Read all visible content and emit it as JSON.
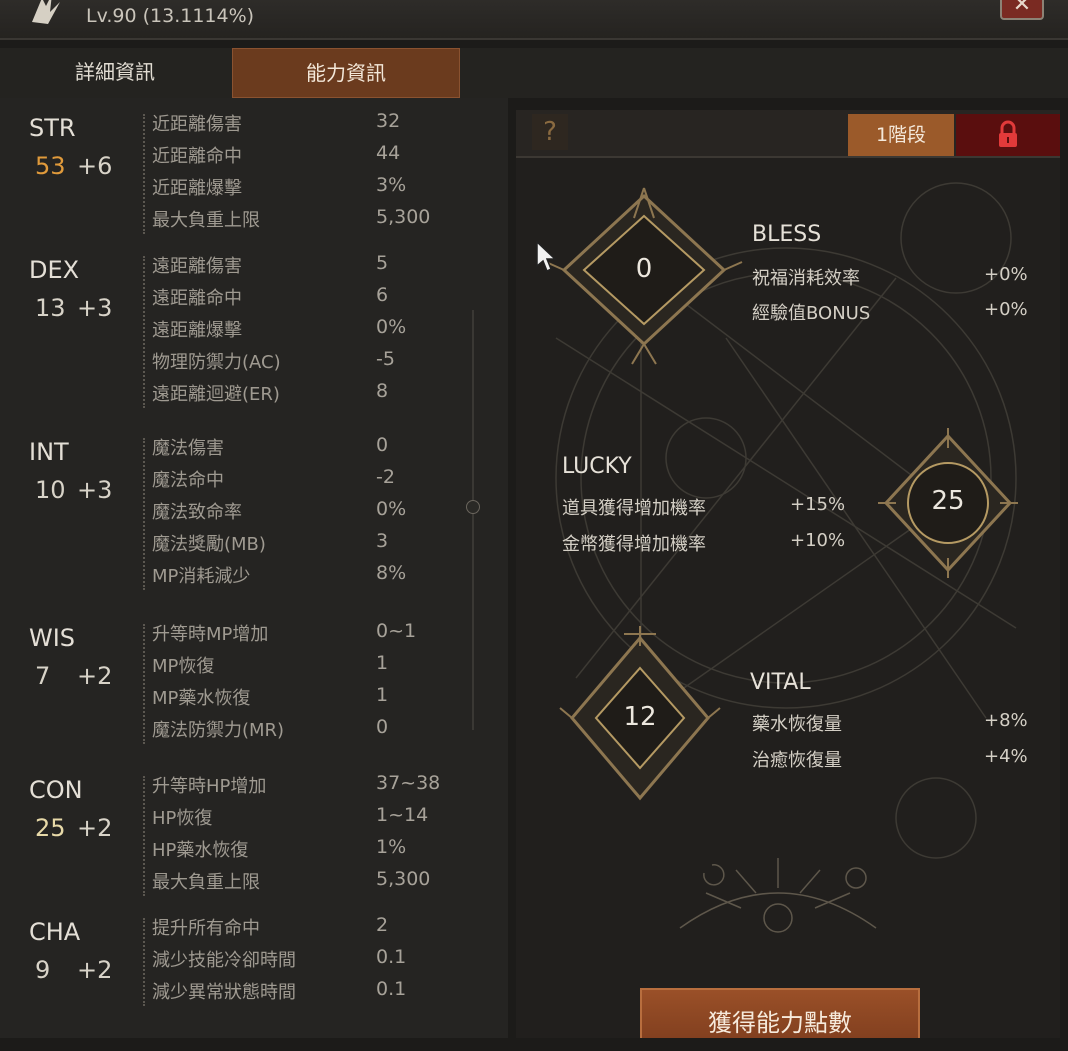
{
  "window": {
    "level_text": "Lv.90 (13.1114%)",
    "close_icon": "close-x-icon"
  },
  "tabs": [
    {
      "label": "詳細資訊",
      "active": false
    },
    {
      "label": "能力資訊",
      "active": true
    }
  ],
  "stats": [
    {
      "name": "STR",
      "base": "53",
      "bonus": "+6",
      "color": "#e09a3b",
      "attrs": [
        [
          "近距離傷害",
          "32"
        ],
        [
          "近距離命中",
          "44"
        ],
        [
          "近距離爆擊",
          "3%"
        ],
        [
          "最大負重上限",
          "5,300"
        ]
      ]
    },
    {
      "name": "DEX",
      "base": "13",
      "bonus": "+3",
      "color": "#d8d3c8",
      "attrs": [
        [
          "遠距離傷害",
          "5"
        ],
        [
          "遠距離命中",
          "6"
        ],
        [
          "遠距離爆擊",
          "0%"
        ],
        [
          "物理防禦力(AC)",
          "-5"
        ],
        [
          "遠距離迴避(ER)",
          "8"
        ]
      ]
    },
    {
      "name": "INT",
      "base": "10",
      "bonus": "+3",
      "color": "#d8d3c8",
      "attrs": [
        [
          "魔法傷害",
          "0"
        ],
        [
          "魔法命中",
          "-2"
        ],
        [
          "魔法致命率",
          "0%"
        ],
        [
          "魔法獎勵(MB)",
          "3"
        ],
        [
          "MP消耗減少",
          "8%"
        ]
      ]
    },
    {
      "name": "WIS",
      "base": "7",
      "bonus": "+2",
      "color": "#d8d3c8",
      "attrs": [
        [
          "升等時MP增加",
          "0~1"
        ],
        [
          "MP恢復",
          "1"
        ],
        [
          "MP藥水恢復",
          "1"
        ],
        [
          "魔法防禦力(MR)",
          "0"
        ]
      ]
    },
    {
      "name": "CON",
      "base": "25",
      "bonus": "+2",
      "color": "#e7d9a8",
      "attrs": [
        [
          "升等時HP增加",
          "37~38"
        ],
        [
          "HP恢復",
          "1~14"
        ],
        [
          "HP藥水恢復",
          "1%"
        ],
        [
          "最大負重上限",
          "5,300"
        ]
      ]
    },
    {
      "name": "CHA",
      "base": "9",
      "bonus": "+2",
      "color": "#d8d3c8",
      "attrs": [
        [
          "提升所有命中",
          "2"
        ],
        [
          "減少技能冷卻時間",
          "0.1"
        ],
        [
          "減少異常狀態時間",
          "0.1"
        ]
      ]
    }
  ],
  "right": {
    "help_label": "?",
    "stage_label": "1階段",
    "lock_icon": "lock-icon",
    "bless": {
      "title": "BLESS",
      "points": "0",
      "rows": [
        [
          "祝福消耗效率",
          "+0%"
        ],
        [
          "經驗值BONUS",
          "+0%"
        ]
      ]
    },
    "lucky": {
      "title": "LUCKY",
      "points": "25",
      "rows": [
        [
          "道具獲得增加機率",
          "+15%"
        ],
        [
          "金幣獲得增加機率",
          "+10%"
        ]
      ]
    },
    "vital": {
      "title": "VITAL",
      "points": "12",
      "rows": [
        [
          "藥水恢復量",
          "+8%"
        ],
        [
          "治癒恢復量",
          "+4%"
        ]
      ]
    },
    "gain_button": "獲得能力點數"
  }
}
